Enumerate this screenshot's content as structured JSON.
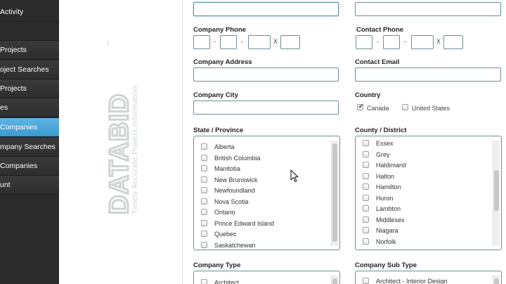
{
  "sidebar": {
    "items": [
      {
        "label": "Activity"
      },
      {
        "label": ""
      },
      {
        "label": "Projects"
      },
      {
        "label": "oject Searches"
      },
      {
        "label": "Projects"
      },
      {
        "label": "es"
      },
      {
        "label": "Companies",
        "active": true
      },
      {
        "label": "mpany Searches"
      },
      {
        "label": "Companies"
      },
      {
        "label": "unt"
      }
    ]
  },
  "logo": {
    "text": "DATABID",
    "tagline": "Timely Accurate Project Information",
    "tm": "TM",
    "color": "#cfd3d4"
  },
  "form": {
    "company_phone": {
      "label": "Company Phone",
      "sep1": "-",
      "sep2": "-",
      "ext": "X"
    },
    "contact_phone": {
      "label": "Contact Phone",
      "sep1": "-",
      "sep2": "-",
      "ext": "X"
    },
    "company_address": {
      "label": "Company Address",
      "value": ""
    },
    "contact_email": {
      "label": "Contact Email",
      "value": ""
    },
    "company_city": {
      "label": "Company City",
      "value": ""
    },
    "country": {
      "label": "Country",
      "options": [
        {
          "label": "Canada",
          "checked": true
        },
        {
          "label": "United States",
          "checked": false
        }
      ]
    },
    "state_province": {
      "label": "State / Province",
      "items": [
        "Alberta",
        "British Columbia",
        "Manitoba",
        "New Brunswick",
        "Newfoundland",
        "Nova Scotia",
        "Ontario",
        "Prince Edward Island",
        "Quebec",
        "Saskatchewan"
      ]
    },
    "county_district": {
      "label": "County / District",
      "items": [
        "Essex",
        "Grey",
        "Haldimand",
        "Halton",
        "Hamilton",
        "Huron",
        "Lambton",
        "Middlesex",
        "Niagara",
        "Norfolk"
      ]
    },
    "company_type": {
      "label": "Company Type",
      "items": [
        "Architect"
      ]
    },
    "company_sub_type": {
      "label": "Company Sub Type",
      "items": [
        "Architect - Interior Design"
      ]
    }
  },
  "colors": {
    "accent": "#3a9bd1",
    "sidebar_bg": "#2b2b2b",
    "input_border": "#6e8f95"
  }
}
